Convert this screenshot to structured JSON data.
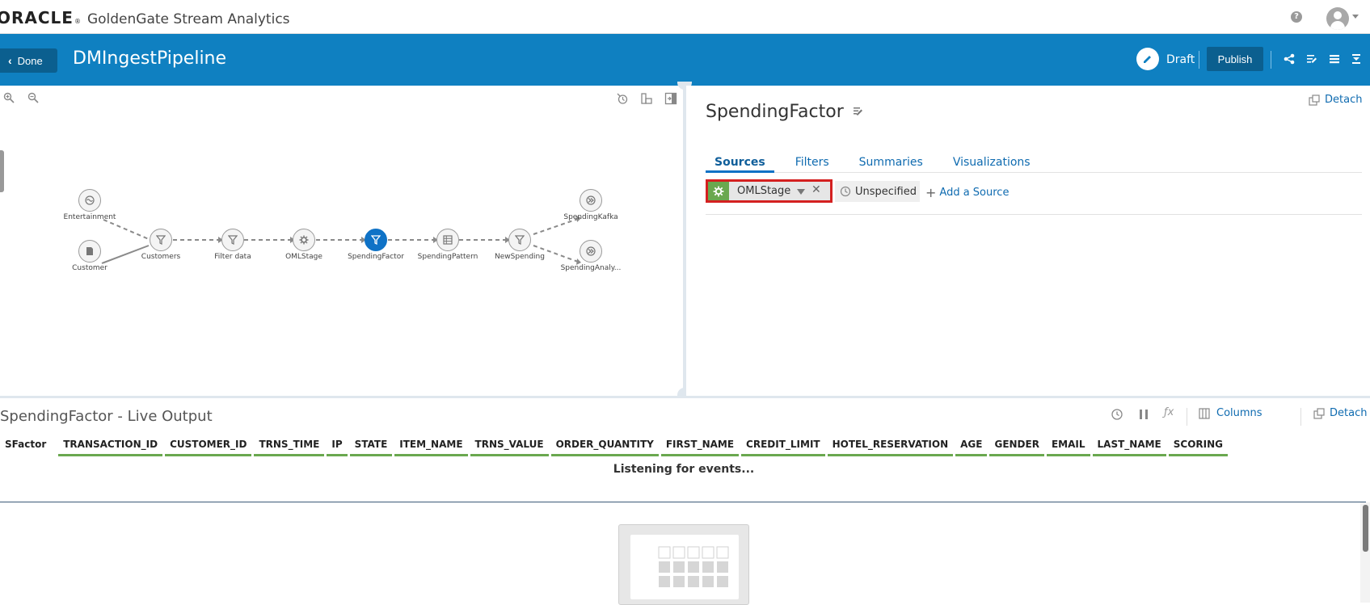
{
  "topbar": {
    "brand": "ORACLE",
    "app_name": "GoldenGate Stream Analytics",
    "help_label": "?"
  },
  "header": {
    "done_label": "Done",
    "pipeline_name": "DMIngestPipeline",
    "status": "Draft",
    "publish_label": "Publish"
  },
  "canvas": {
    "nodes": [
      {
        "label": "Entertainment"
      },
      {
        "label": "Customer"
      },
      {
        "label": "Customers"
      },
      {
        "label": "Filter data"
      },
      {
        "label": "OMLStage"
      },
      {
        "label": "SpendingFactor"
      },
      {
        "label": "SpendingPattern"
      },
      {
        "label": "NewSpending"
      },
      {
        "label": "SpendingKafka"
      },
      {
        "label": "SpendingAnaly..."
      }
    ]
  },
  "detail": {
    "stage_name": "SpendingFactor",
    "detach_label": "Detach",
    "tabs": [
      "Sources",
      "Filters",
      "Summaries",
      "Visualizations"
    ],
    "source": {
      "name": "OMLStage",
      "time_window": "Unspecified",
      "add_label": "Add a Source"
    }
  },
  "live_output": {
    "title": "SpendingFactor - Live Output",
    "columns_label": "Columns",
    "detach_label": "Detach",
    "headers": [
      "SFactor",
      "TRANSACTION_ID",
      "CUSTOMER_ID",
      "TRNS_TIME",
      "IP",
      "STATE",
      "ITEM_NAME",
      "TRNS_VALUE",
      "ORDER_QUANTITY",
      "FIRST_NAME",
      "CREDIT_LIMIT",
      "HOTEL_RESERVATION",
      "AGE",
      "GENDER",
      "EMAIL",
      "LAST_NAME",
      "SCORING"
    ],
    "status_message": "Listening for events..."
  },
  "colors": {
    "header_blue": "#0f80c1",
    "active_node": "#0f72c6",
    "source_highlight": "#d42020",
    "accent_green": "#6aa84f"
  }
}
